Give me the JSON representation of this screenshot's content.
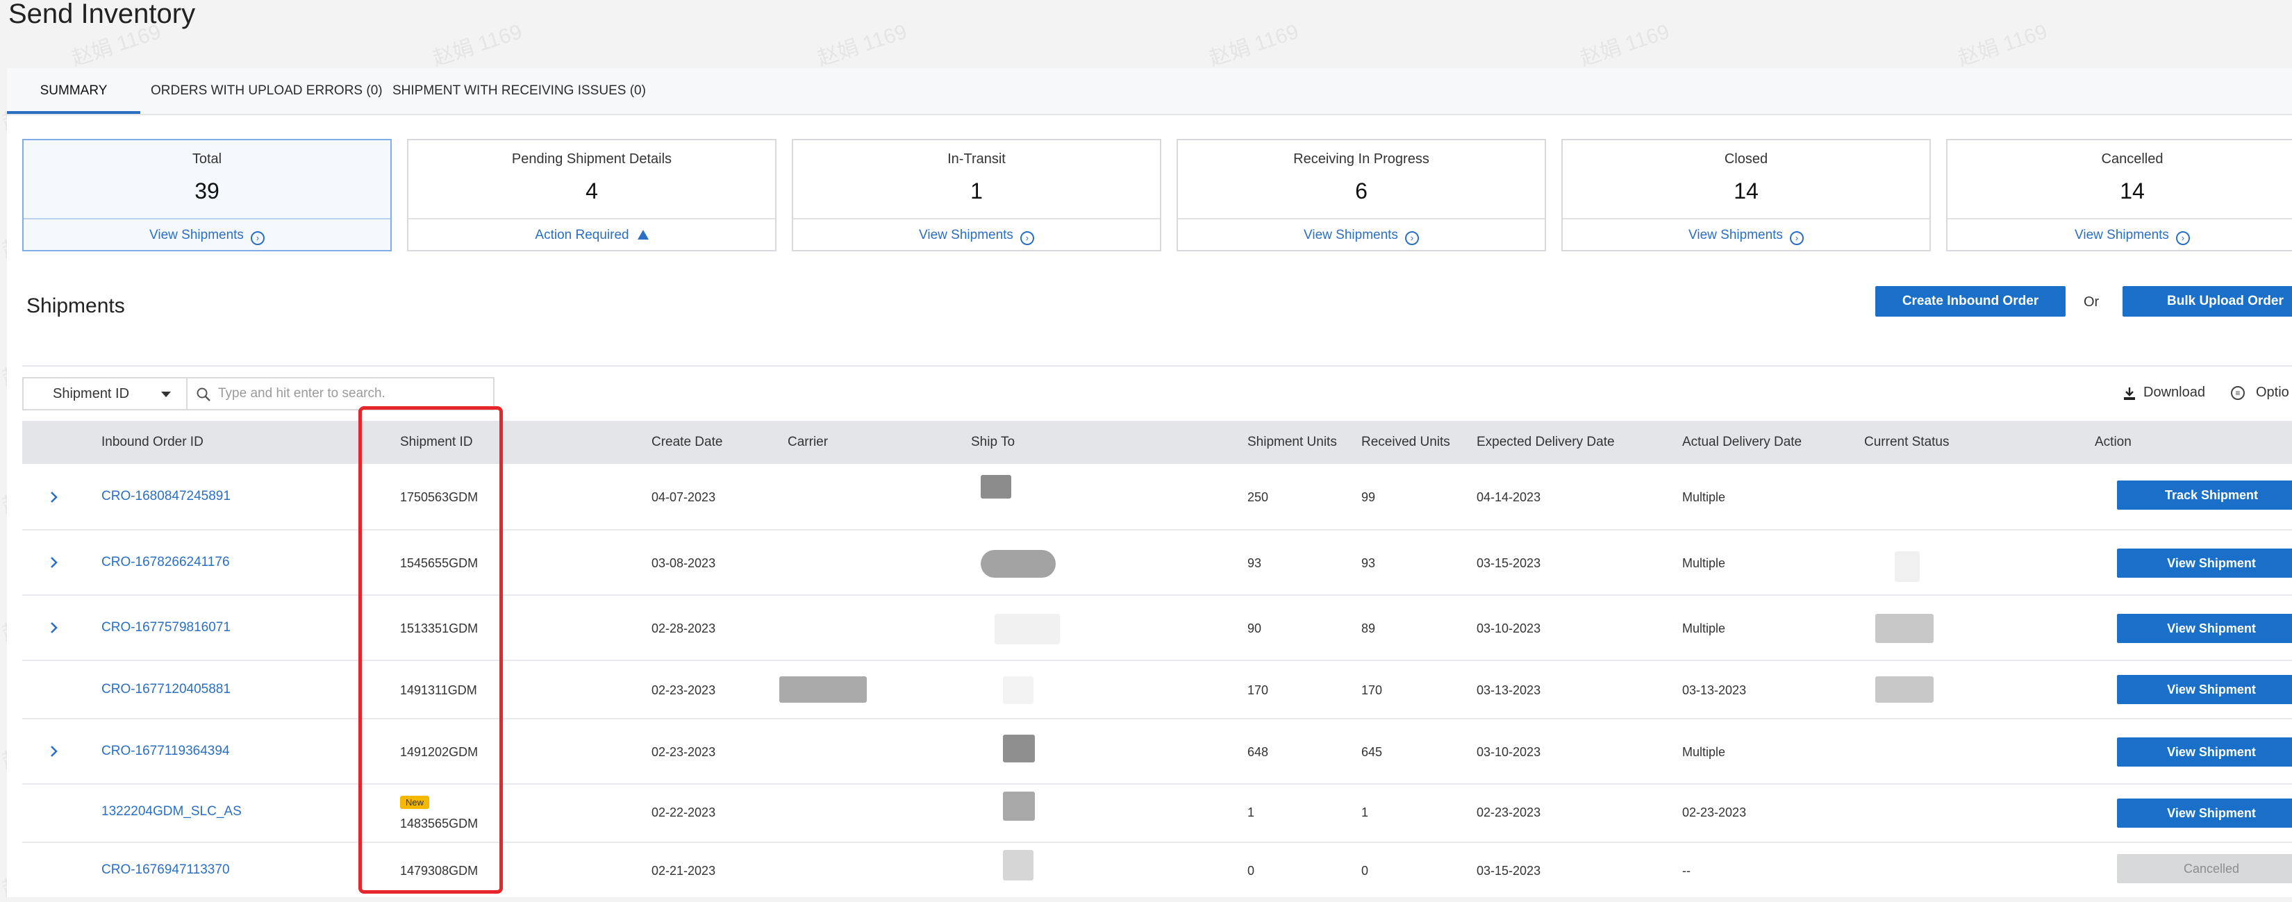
{
  "page": {
    "title": "Send Inventory"
  },
  "tabs": [
    {
      "label": "SUMMARY"
    },
    {
      "label": "ORDERS WITH UPLOAD ERRORS (0)"
    },
    {
      "label": "SHIPMENT WITH RECEIVING ISSUES (0)"
    }
  ],
  "summary_cards": [
    {
      "label": "Total",
      "count": "39",
      "footer": "View Shipments",
      "footer_icon": "chevron-circle-icon"
    },
    {
      "label": "Pending Shipment Details",
      "count": "4",
      "footer": "Action Required",
      "footer_icon": "warning-icon"
    },
    {
      "label": "In-Transit",
      "count": "1",
      "footer": "View Shipments",
      "footer_icon": "chevron-circle-icon"
    },
    {
      "label": "Receiving In Progress",
      "count": "6",
      "footer": "View Shipments",
      "footer_icon": "chevron-circle-icon"
    },
    {
      "label": "Closed",
      "count": "14",
      "footer": "View Shipments",
      "footer_icon": "chevron-circle-icon"
    },
    {
      "label": "Cancelled",
      "count": "14",
      "footer": "View Shipments",
      "footer_icon": "chevron-circle-icon"
    }
  ],
  "shipments": {
    "title": "Shipments",
    "create_button": "Create Inbound Order",
    "or_text": "Or",
    "bulk_button": "Bulk Upload Order",
    "search": {
      "filter": "Shipment ID",
      "placeholder": "Type and hit enter to search."
    },
    "download_label": "Download",
    "options_label": "Optio",
    "columns": [
      "Inbound Order ID",
      "Shipment ID",
      "Create Date",
      "Carrier",
      "Ship To",
      "Shipment Units",
      "Received Units",
      "Expected Delivery Date",
      "Actual Delivery Date",
      "Current Status",
      "Action"
    ],
    "rows": [
      {
        "order_id": "CRO-1680847245891",
        "shipment_id": "1750563GDM",
        "create_date": "04-07-2023",
        "shipment_units": "250",
        "received_units": "99",
        "expected": "04-14-2023",
        "actual": "Multiple",
        "action": "Track Shipment",
        "badge": "",
        "expandable": true
      },
      {
        "order_id": "CRO-1678266241176",
        "shipment_id": "1545655GDM",
        "create_date": "03-08-2023",
        "shipment_units": "93",
        "received_units": "93",
        "expected": "03-15-2023",
        "actual": "Multiple",
        "action": "View Shipment",
        "badge": "",
        "expandable": true
      },
      {
        "order_id": "CRO-1677579816071",
        "shipment_id": "1513351GDM",
        "create_date": "02-28-2023",
        "shipment_units": "90",
        "received_units": "89",
        "expected": "03-10-2023",
        "actual": "Multiple",
        "action": "View Shipment",
        "badge": "",
        "expandable": true
      },
      {
        "order_id": "CRO-1677120405881",
        "shipment_id": "1491311GDM",
        "create_date": "02-23-2023",
        "shipment_units": "170",
        "received_units": "170",
        "expected": "03-13-2023",
        "actual": "03-13-2023",
        "action": "View Shipment",
        "badge": "",
        "expandable": false
      },
      {
        "order_id": "CRO-1677119364394",
        "shipment_id": "1491202GDM",
        "create_date": "02-23-2023",
        "shipment_units": "648",
        "received_units": "645",
        "expected": "03-10-2023",
        "actual": "Multiple",
        "action": "View Shipment",
        "badge": "",
        "expandable": true
      },
      {
        "order_id": "1322204GDM_SLC_AS",
        "shipment_id": "1483565GDM",
        "create_date": "02-22-2023",
        "shipment_units": "1",
        "received_units": "1",
        "expected": "02-23-2023",
        "actual": "02-23-2023",
        "action": "View Shipment",
        "badge": "New",
        "expandable": false
      },
      {
        "order_id": "CRO-1676947113370",
        "shipment_id": "1479308GDM",
        "create_date": "02-21-2023",
        "shipment_units": "0",
        "received_units": "0",
        "expected": "03-15-2023",
        "actual": "--",
        "action": "Cancelled",
        "badge": "",
        "expandable": false
      }
    ]
  },
  "watermark": "赵娟 1169",
  "colors": {
    "accent": "#1a6fc9",
    "link": "#2a6fc4",
    "highlight": "#e6262b",
    "badge": "#f5b800"
  }
}
